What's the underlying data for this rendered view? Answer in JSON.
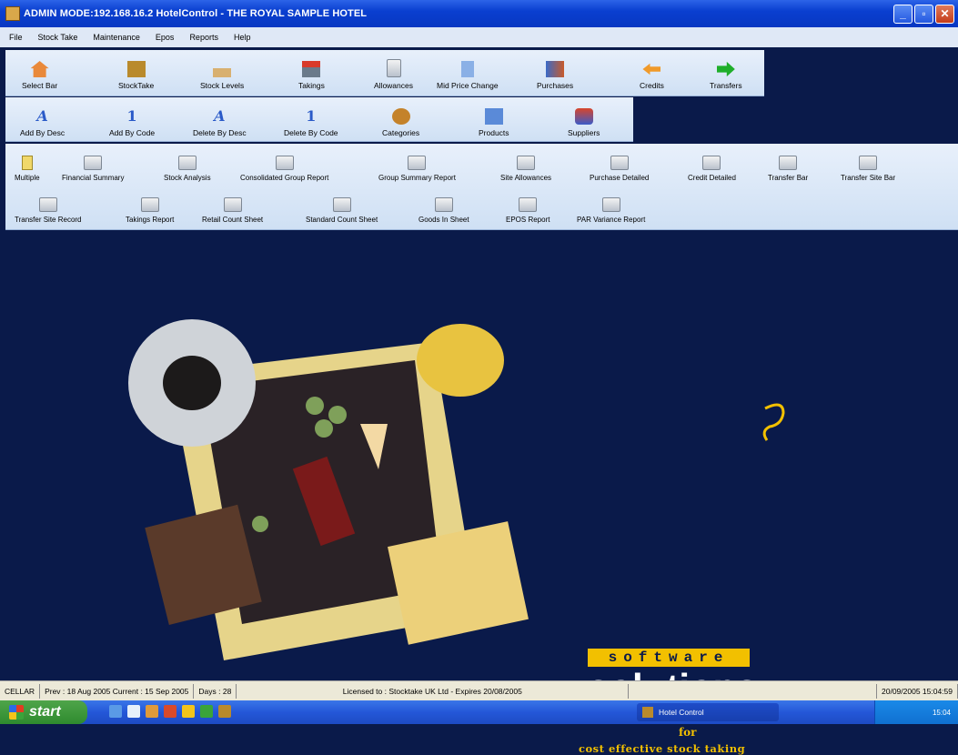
{
  "window": {
    "title": "ADMIN MODE:192.168.16.2 HotelControl  -  THE ROYAL SAMPLE HOTEL"
  },
  "menu": [
    "File",
    "Stock Take",
    "Maintenance",
    "Epos",
    "Reports",
    "Help"
  ],
  "toolbar1": [
    "Select Bar",
    "StockTake",
    "Stock Levels",
    "Takings",
    "Allowances",
    "Mid Price Change",
    "Purchases",
    "Credits",
    "Transfers"
  ],
  "toolbar2": [
    "Add By Desc",
    "Add By Code",
    "Delete By Desc",
    "Delete By Code",
    "Categories",
    "Products",
    "Suppliers"
  ],
  "reports_row1": [
    "Multiple",
    "Financial Summary",
    "Stock Analysis",
    "Consolidated Group Report",
    "Group Summary Report",
    "Site Allowances",
    "Purchase Detailed",
    "Credit Detailed",
    "Transfer Bar",
    "Transfer Site Bar"
  ],
  "reports_row2": [
    "Transfer Site Record",
    "Takings Report",
    "Retail Count Sheet",
    "Standard Count Sheet",
    "Goods In Sheet",
    "EPOS Report",
    "PAR Variance Report"
  ],
  "logo": {
    "line1": "software",
    "line2": "solutions",
    "line3": "for",
    "line4": "cost effective stock taking"
  },
  "status": {
    "location": "CELLAR",
    "dates": "Prev : 18 Aug 2005  Current : 15 Sep 2005",
    "days": "Days : 28",
    "license": "Licensed to : Stocktake UK Ltd - Expires 20/08/2005",
    "datetime": "20/09/2005 15:04:59"
  },
  "taskbar": {
    "start": "start",
    "task": "Hotel Control",
    "clock": "15:04"
  }
}
